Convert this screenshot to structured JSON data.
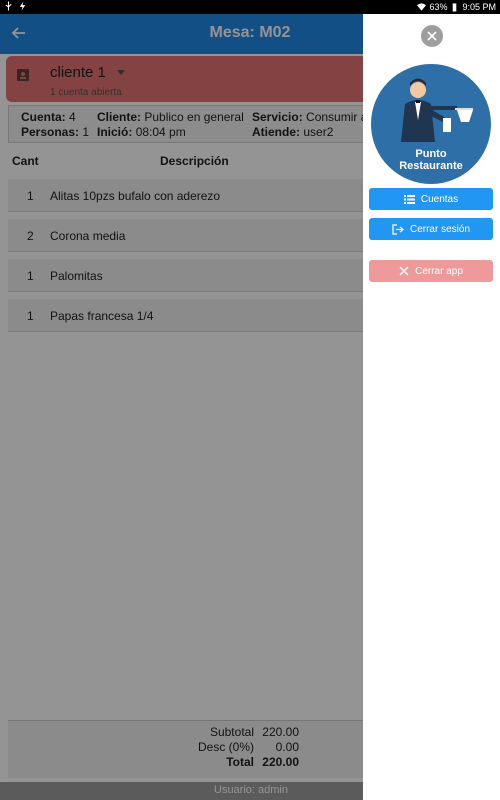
{
  "status_bar": {
    "battery": "63%",
    "time": "9:05 PM",
    "icons": [
      "usb-icon",
      "charging-icon",
      "wifi-icon",
      "battery-icon"
    ]
  },
  "header": {
    "title": "Mesa: M02",
    "back_icon": "arrow-left-icon"
  },
  "client": {
    "name": "cliente 1",
    "subtitle": "1 cuenta abierta",
    "icon": "contact-card-icon"
  },
  "info": {
    "cuenta_label": "Cuenta:",
    "cuenta_value": "4",
    "personas_label": "Personas:",
    "personas_value": "1",
    "cliente_label": "Cliente:",
    "cliente_value": "Publico en general",
    "inicio_label": "Inició:",
    "inicio_value": "08:04 pm",
    "servicio_label": "Servicio:",
    "servicio_value": "Consumir a",
    "atiende_label": "Atiende:",
    "atiende_value": "user2"
  },
  "table": {
    "headers": [
      "Cant",
      "Descripción"
    ],
    "rows": [
      {
        "qty": "1",
        "desc": "Alitas 10pzs bufalo con aderezo"
      },
      {
        "qty": "2",
        "desc": "Corona media"
      },
      {
        "qty": "1",
        "desc": "Palomitas"
      },
      {
        "qty": "1",
        "desc": "Papas francesa 1/4"
      }
    ]
  },
  "totals": {
    "subtotal_label": "Subtotal",
    "subtotal_value": "220.00",
    "desc_label": "Desc (0%)",
    "desc_value": "0.00",
    "total_label": "Total",
    "total_value": "220.00"
  },
  "footer": {
    "user_text": "Usuario: admin"
  },
  "drawer": {
    "logo_line1": "Punto",
    "logo_line2": "Restaurante",
    "buttons": [
      {
        "label": "Cuentas",
        "icon": "list-icon"
      },
      {
        "label": "Cerrar sesión",
        "icon": "logout-icon"
      },
      {
        "label": "Cerrar app",
        "icon": "close-icon"
      }
    ]
  },
  "colors": {
    "primary": "#1e88e5",
    "client_card": "#e57373",
    "drawer_button": "#2196f3",
    "close_app_button": "#ef9a9a"
  }
}
